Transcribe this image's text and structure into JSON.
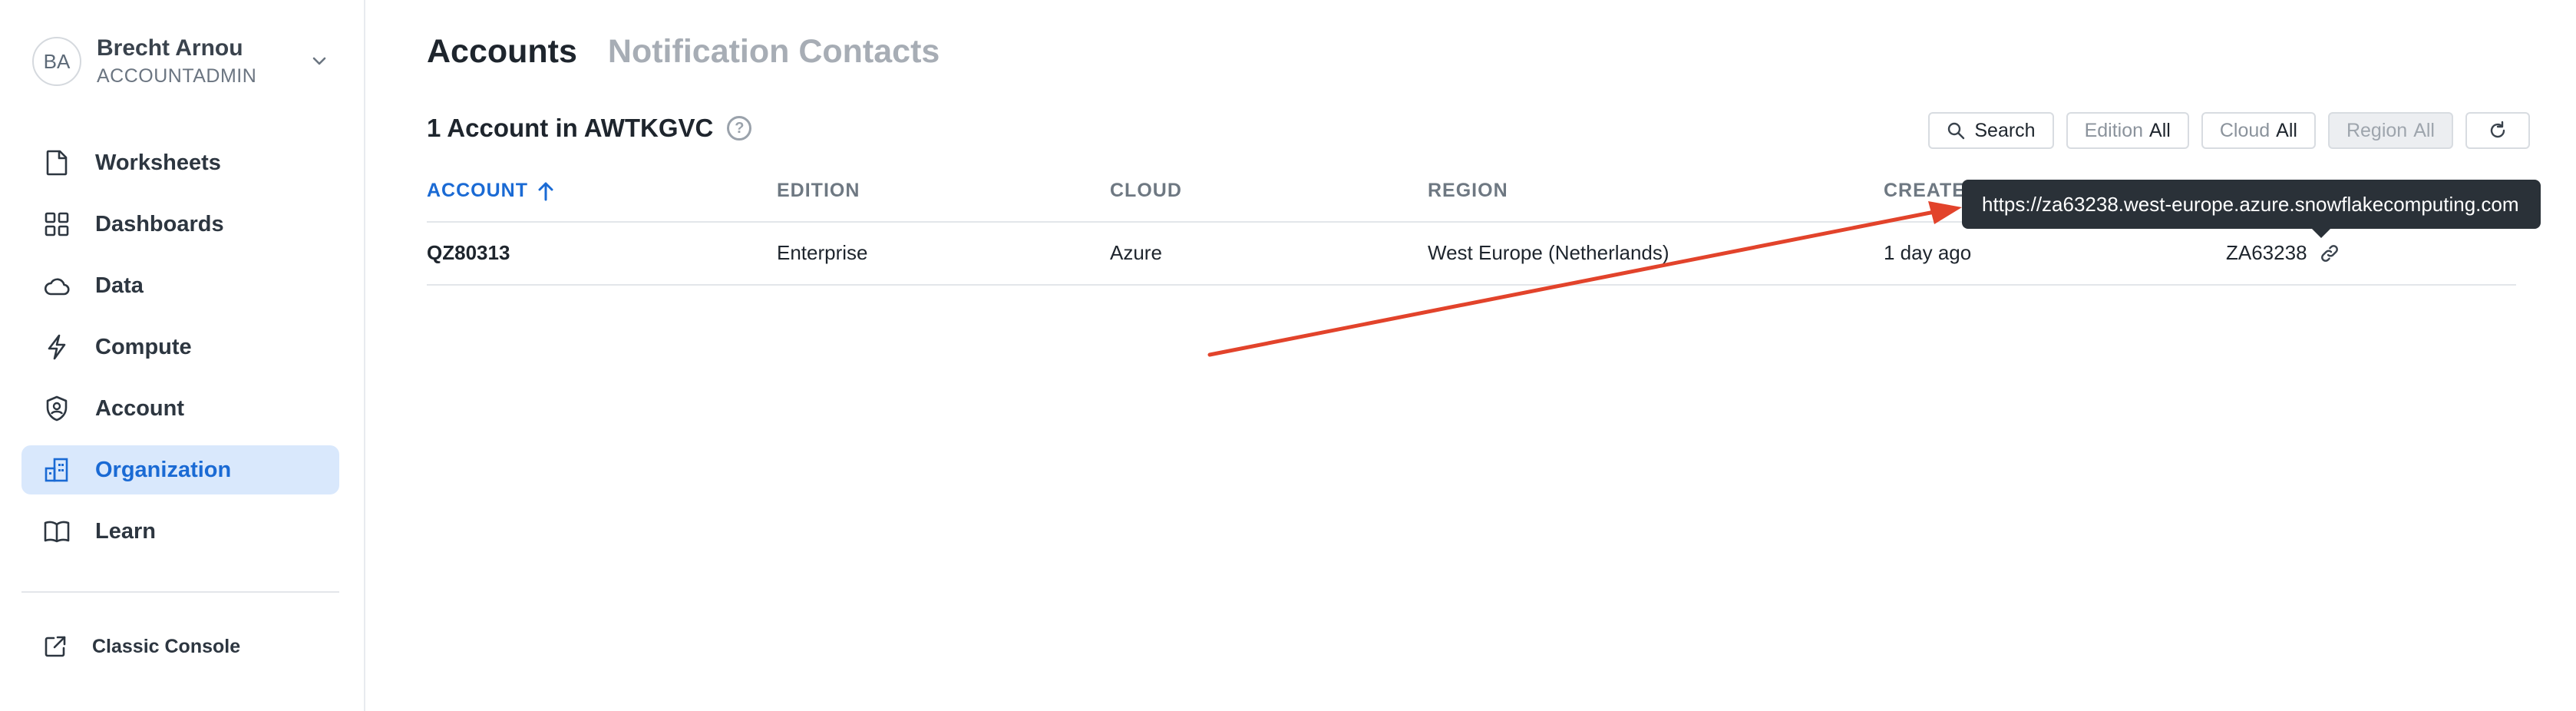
{
  "user": {
    "initials": "BA",
    "name": "Brecht Arnou",
    "role": "ACCOUNTADMIN"
  },
  "nav": {
    "items": [
      {
        "label": "Worksheets",
        "icon": "file-icon"
      },
      {
        "label": "Dashboards",
        "icon": "grid-icon"
      },
      {
        "label": "Data",
        "icon": "cloud-icon"
      },
      {
        "label": "Compute",
        "icon": "lightning-icon"
      },
      {
        "label": "Account",
        "icon": "shield-user-icon"
      },
      {
        "label": "Organization",
        "icon": "building-icon",
        "active": true
      },
      {
        "label": "Learn",
        "icon": "book-icon"
      }
    ],
    "classic_console": "Classic Console"
  },
  "tabs": [
    {
      "label": "Accounts",
      "active": true
    },
    {
      "label": "Notification Contacts",
      "active": false
    }
  ],
  "page": {
    "count_title": "1 Account in AWTKGVC"
  },
  "filters": {
    "search_label": "Search",
    "edition": {
      "key": "Edition",
      "value": "All"
    },
    "cloud": {
      "key": "Cloud",
      "value": "All"
    },
    "region": {
      "key": "Region",
      "value": "All"
    }
  },
  "table": {
    "columns": [
      "ACCOUNT",
      "EDITION",
      "CLOUD",
      "REGION",
      "CREATED"
    ],
    "rows": [
      {
        "account": "QZ80313",
        "edition": "Enterprise",
        "cloud": "Azure",
        "region": "West Europe (Netherlands)",
        "created": "1 day ago",
        "locator": "ZA63238"
      }
    ]
  },
  "tooltip": {
    "text": "https://za63238.west-europe.azure.snowflakecomputing.com"
  },
  "colors": {
    "accent": "#1a6ad4",
    "active_bg": "#d9e8fc",
    "annotation_arrow": "#e2432b",
    "tooltip_bg": "#2a3138"
  }
}
